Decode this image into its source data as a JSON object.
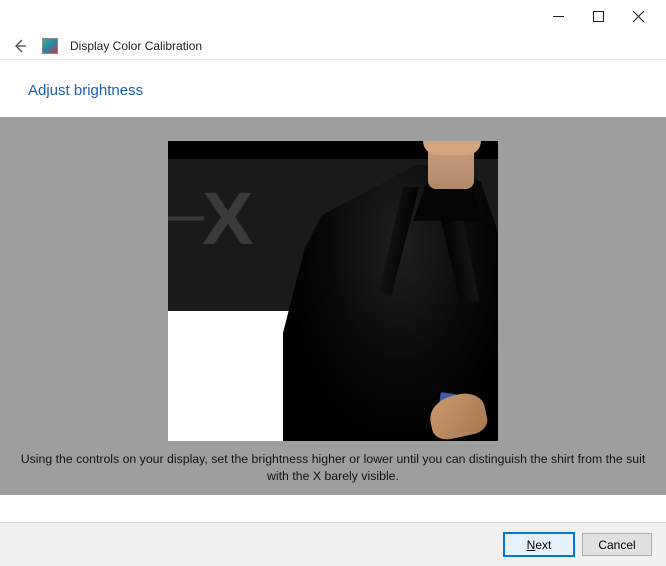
{
  "window": {
    "title": "Display Color Calibration"
  },
  "page": {
    "heading": "Adjust brightness",
    "instruction": "Using the controls on your display, set the brightness higher or lower until you can distinguish the shirt from the suit with the X barely visible."
  },
  "buttons": {
    "next_prefix": "N",
    "next_rest": "ext",
    "cancel": "Cancel"
  },
  "icons": {
    "back": "back-arrow-icon",
    "app": "display-color-calibration-icon",
    "minimize": "minimize-icon",
    "maximize": "maximize-icon",
    "close": "close-icon"
  }
}
